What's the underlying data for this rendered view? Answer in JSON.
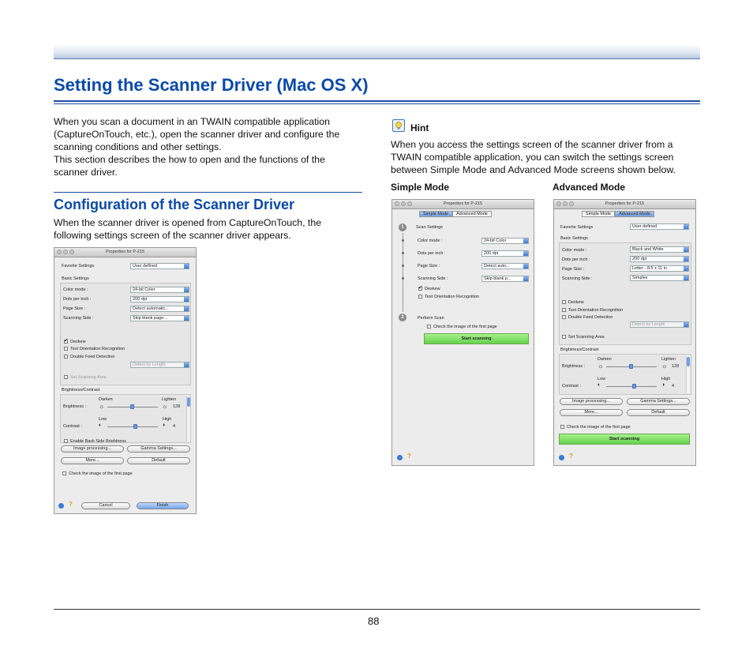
{
  "page": {
    "title": "Setting the Scanner Driver (Mac OS X)",
    "intro": [
      "When you scan a document in an TWAIN compatible application",
      "(CaptureOnTouch, etc.), open the scanner driver and configure the",
      "scanning conditions and other settings.",
      "This section describes the how to open and the functions of the",
      "scanner driver."
    ],
    "section_title": "Configuration of the Scanner Driver",
    "section_text": [
      "When the scanner driver is opened from CaptureOnTouch, the",
      "following settings screen of the scanner driver appears."
    ],
    "hint": {
      "label": "Hint",
      "lines": [
        "When you access the settings screen of the scanner driver from a",
        "TWAIN compatible application, you can switch the settings screen",
        "between Simple Mode and Advanced Mode screens shown below."
      ]
    },
    "simple_mode_label": "Simple Mode",
    "advanced_mode_label": "Advanced Mode",
    "page_number": "88"
  },
  "dialog_main": {
    "title": "Properties for P-215",
    "favorite_label": "Favorite Settings",
    "favorite_value": "User defined",
    "basic_settings": "Basic Settings",
    "color_mode_label": "Color mode :",
    "color_mode_value": "24-bit Color",
    "dpi_label": "Dots per inch :",
    "dpi_value": "200 dpi",
    "page_size_label": "Page Size :",
    "page_size_value": "Detect automatic...",
    "scanning_side_label": "Scanning Side :",
    "scanning_side_value": "Skip blank page...",
    "deskew": "Deskew",
    "text_orientation": "Text Orientation Recognition",
    "double_feed": "Double Feed Detection",
    "detect_by_length": "Detect by Length",
    "set_scanning_area": "Set Scanning Area",
    "brightness_contrast": "Brightness/Contrast",
    "brightness_label": "Brightness :",
    "darken": "Darken",
    "lighten": "Lighten",
    "brightness_value": "128",
    "contrast_label": "Contrast :",
    "low": "Low",
    "high": "High",
    "contrast_value": "4",
    "enable_back_side": "Enable Back Side Brightness",
    "image_processing": "Image processing...",
    "gamma_settings": "Gamma Settings...",
    "more": "More...",
    "default": "Default",
    "check_image": "Check the image of the first page",
    "cancel": "Cancel",
    "finish": "Finish"
  },
  "dialog_simple": {
    "title": "Properties for P-215",
    "tab_simple": "Simple Mode",
    "tab_advanced": "Advanced Mode",
    "step1": "1",
    "step2": "2",
    "scan_settings": "Scan Settings",
    "color_mode_label": "Color mode :",
    "color_mode_value": "24-bit Color",
    "dpi_label": "Dots per inch :",
    "dpi_value": "200 dpi",
    "page_size_label": "Page Size :",
    "page_size_value": "Detect auto...",
    "scanning_side_label": "Scanning Side :",
    "scanning_side_value": "Skip blank p...",
    "deskew": "Deskew",
    "text_orientation": "Text Orientation Recognition",
    "perform_scan": "Perform Scan",
    "check_image": "Check the image of the first page",
    "start_scanning": "Start scanning"
  },
  "dialog_advanced": {
    "title": "Properties for P-215",
    "tab_simple": "Simple Mode",
    "tab_advanced": "Advanced Mode",
    "favorite_label": "Favorite Settings",
    "favorite_value": "User defined",
    "basic_settings": "Basic Settings",
    "color_mode_label": "Color mode :",
    "color_mode_value": "Black and White",
    "dpi_label": "Dots per inch :",
    "dpi_value": "200 dpi",
    "page_size_label": "Page Size :",
    "page_size_value": "Letter - 8.5 x 11 in",
    "scanning_side_label": "Scanning Side :",
    "scanning_side_value": "Simplex",
    "deskew": "Deskew",
    "text_orientation": "Text Orientation Recognition",
    "double_feed": "Double Feed Detection",
    "detect_by_length": "Detect by Length",
    "set_scanning_area": "Set Scanning Area",
    "brightness_contrast": "Brightness/Contrast",
    "brightness_label": "Brightness :",
    "darken": "Darken",
    "lighten": "Lighten",
    "brightness_value": "128",
    "contrast_label": "Contrast :",
    "low": "Low",
    "high": "High",
    "contrast_value": "4",
    "image_processing": "Image processing...",
    "gamma_settings": "Gamma Settings...",
    "more": "More...",
    "default": "Default",
    "check_image": "Check the image of the first page",
    "start_scanning": "Start scanning"
  }
}
